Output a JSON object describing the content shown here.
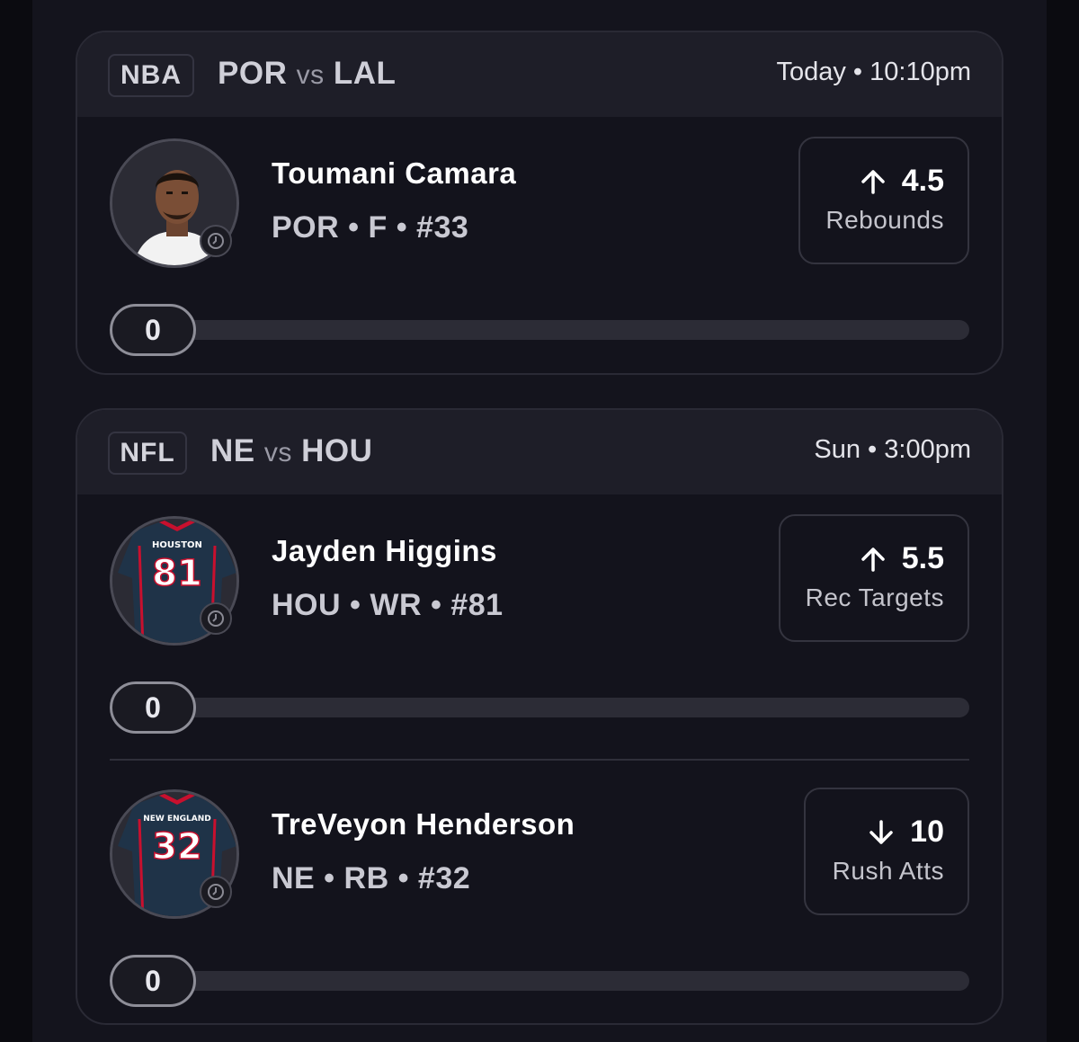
{
  "games": [
    {
      "league": "NBA",
      "home": "POR",
      "vs": "vs",
      "away": "LAL",
      "time": "Today • 10:10pm",
      "players": [
        {
          "name": "Toumani Camara",
          "meta": "POR • F • #33",
          "direction": "up",
          "line": "4.5",
          "stat": "Rebounds",
          "progress": "0",
          "avatar": "player-headshot"
        }
      ]
    },
    {
      "league": "NFL",
      "home": "NE",
      "vs": "vs",
      "away": "HOU",
      "time": "Sun • 3:00pm",
      "players": [
        {
          "name": "Jayden Higgins",
          "meta": "HOU • WR • #81",
          "direction": "up",
          "line": "5.5",
          "stat": "Rec Targets",
          "progress": "0",
          "avatar": "jersey",
          "jersey_team": "HOUSTON",
          "jersey_number": "81"
        },
        {
          "name": "TreVeyon Henderson",
          "meta": "NE • RB • #32",
          "direction": "down",
          "line": "10",
          "stat": "Rush Atts",
          "progress": "0",
          "avatar": "jersey",
          "jersey_team": "NEW ENGLAND",
          "jersey_number": "32"
        }
      ]
    }
  ],
  "colors": {
    "background": "#14141d",
    "card_header": "#1e1e28",
    "jersey": "#1f3348",
    "jersey_accent": "#c8102e"
  },
  "icons": [
    "clock-icon",
    "arrow-up-icon",
    "arrow-down-icon"
  ]
}
